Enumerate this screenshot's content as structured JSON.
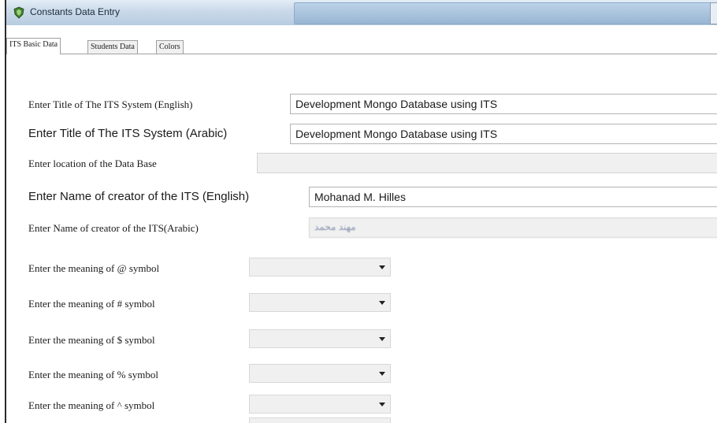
{
  "window": {
    "title": "Constants Data Entry"
  },
  "tabs": [
    {
      "label": "ITS Basic Data",
      "active": true
    },
    {
      "label": "Students Data",
      "active": false
    },
    {
      "label": "Colors",
      "active": false
    }
  ],
  "form": {
    "title_en_label": "Enter Title of The ITS System (English)",
    "title_en_value": "Development Mongo Database using ITS",
    "title_ar_label": "Enter Title of The ITS System (Arabic)",
    "title_ar_value": "Development Mongo Database using ITS",
    "db_location_label": "Enter location of the Data Base",
    "db_location_value": "",
    "creator_en_label": "Enter Name of creator of the ITS (English)",
    "creator_en_value": "Mohanad M. Hilles",
    "creator_ar_label": "Enter Name of creator of the ITS(Arabic)",
    "creator_ar_value": "مهند محمد",
    "symbols": [
      {
        "label": "Enter the meaning of @ symbol",
        "value": ""
      },
      {
        "label": "Enter the meaning of # symbol",
        "value": ""
      },
      {
        "label": "Enter the meaning of $ symbol",
        "value": ""
      },
      {
        "label": "Enter the meaning of % symbol",
        "value": ""
      },
      {
        "label": "Enter the meaning of ^ symbol",
        "value": ""
      }
    ]
  },
  "colors": {
    "titlebar": "#c9d9e9",
    "disabled_field": "#f0f0f0",
    "app_icon": "#3f7f2e"
  },
  "icons": {
    "app": "shield-icon",
    "dropdown": "chevron-down-icon"
  }
}
